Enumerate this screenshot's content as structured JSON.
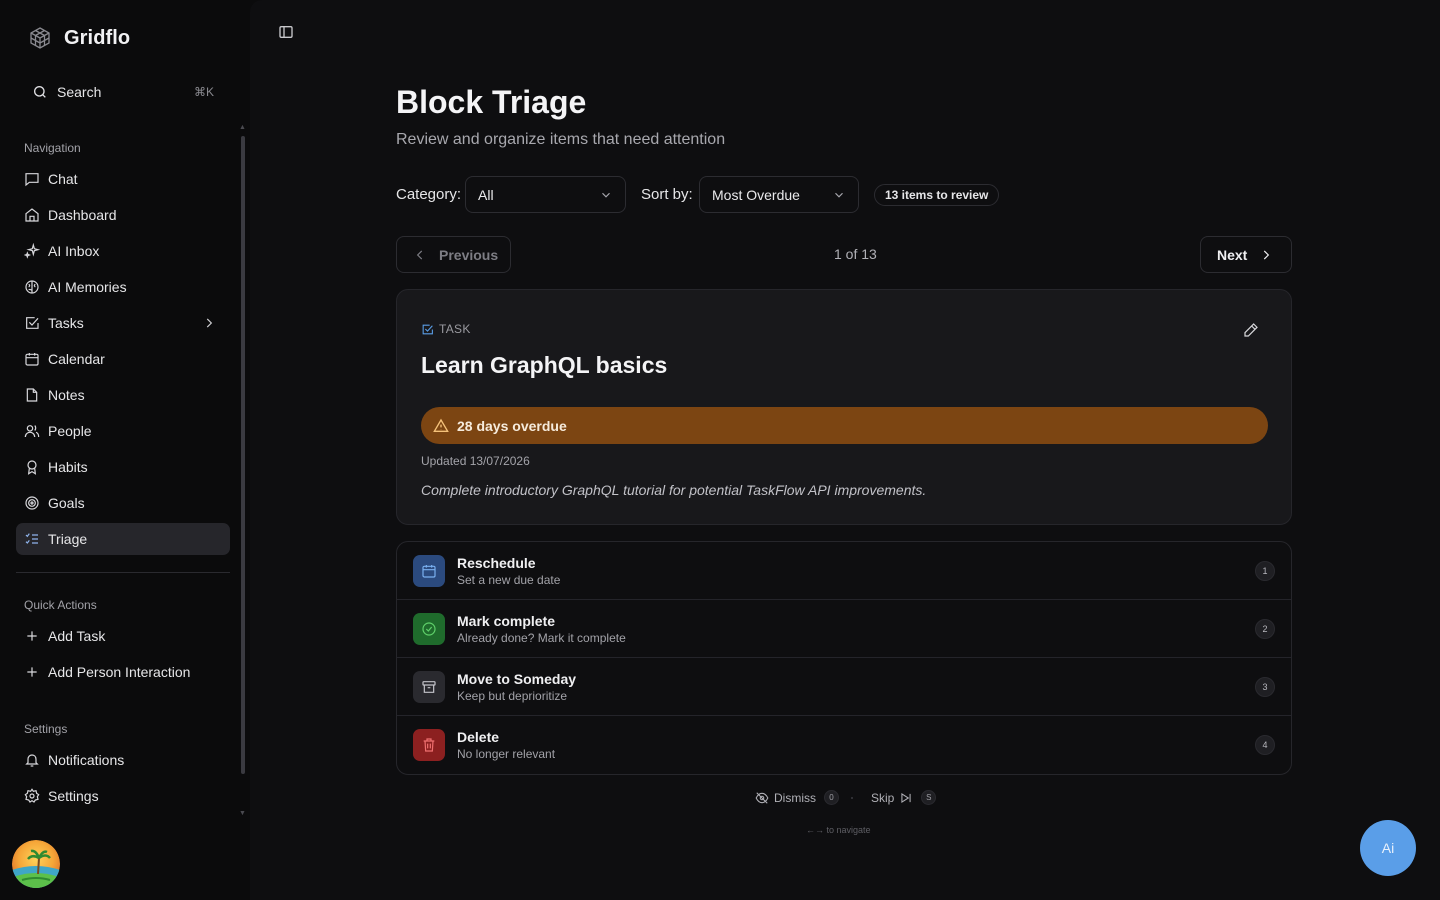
{
  "app": {
    "name": "Gridflo"
  },
  "search": {
    "label": "Search",
    "shortcut": "⌘K"
  },
  "sidebar": {
    "nav_title": "Navigation",
    "nav": [
      {
        "label": "Chat",
        "icon": "message-square-icon"
      },
      {
        "label": "Dashboard",
        "icon": "home-icon"
      },
      {
        "label": "AI Inbox",
        "icon": "sparkles-icon"
      },
      {
        "label": "AI Memories",
        "icon": "brain-icon"
      },
      {
        "label": "Tasks",
        "icon": "check-square-icon"
      },
      {
        "label": "Calendar",
        "icon": "calendar-icon"
      },
      {
        "label": "Notes",
        "icon": "file-icon"
      },
      {
        "label": "People",
        "icon": "users-icon"
      },
      {
        "label": "Habits",
        "icon": "award-icon"
      },
      {
        "label": "Goals",
        "icon": "target-icon"
      },
      {
        "label": "Triage",
        "icon": "list-checks-icon",
        "active": true
      }
    ],
    "quick_title": "Quick Actions",
    "quick": [
      {
        "label": "Add Task",
        "icon": "plus-icon"
      },
      {
        "label": "Add Person Interaction",
        "icon": "plus-icon"
      }
    ],
    "settings_title": "Settings",
    "settings": [
      {
        "label": "Notifications",
        "icon": "bell-icon"
      },
      {
        "label": "Settings",
        "icon": "gear-icon"
      }
    ]
  },
  "page": {
    "title": "Block Triage",
    "subtitle": "Review and organize items that need attention"
  },
  "filters": {
    "category_label": "Category:",
    "category_value": "All",
    "sort_label": "Sort by:",
    "sort_value": "Most Overdue",
    "count_badge": "13 items to review"
  },
  "pager": {
    "previous": "Previous",
    "next": "Next",
    "position": "1 of 13"
  },
  "item": {
    "type": "TASK",
    "title": "Learn GraphQL basics",
    "overdue": "28 days overdue",
    "updated": "Updated 13/07/2026",
    "description": "Complete introductory GraphQL tutorial for potential TaskFlow API improvements."
  },
  "actions": [
    {
      "title": "Reschedule",
      "subtitle": "Set a new due date",
      "key": "1",
      "icon": "calendar-icon",
      "color": "#2b4a7e"
    },
    {
      "title": "Mark complete",
      "subtitle": "Already done? Mark it complete",
      "key": "2",
      "icon": "check-circle-icon",
      "color": "#1f6b2c"
    },
    {
      "title": "Move to Someday",
      "subtitle": "Keep but deprioritize",
      "key": "3",
      "icon": "archive-icon",
      "color": "#2a2a2f"
    },
    {
      "title": "Delete",
      "subtitle": "No longer relevant",
      "key": "4",
      "icon": "trash-icon",
      "color": "#8c2020"
    }
  ],
  "footer": {
    "dismiss": "Dismiss",
    "dismiss_key": "0",
    "skip": "Skip",
    "skip_key": "S",
    "hint": "←→ to navigate"
  },
  "ai_button": {
    "label": "Ai"
  },
  "colors": {
    "overdue_bg": "#7c4512",
    "ai_button": "#5a9ee8",
    "active_nav_bg": "#26262b"
  }
}
